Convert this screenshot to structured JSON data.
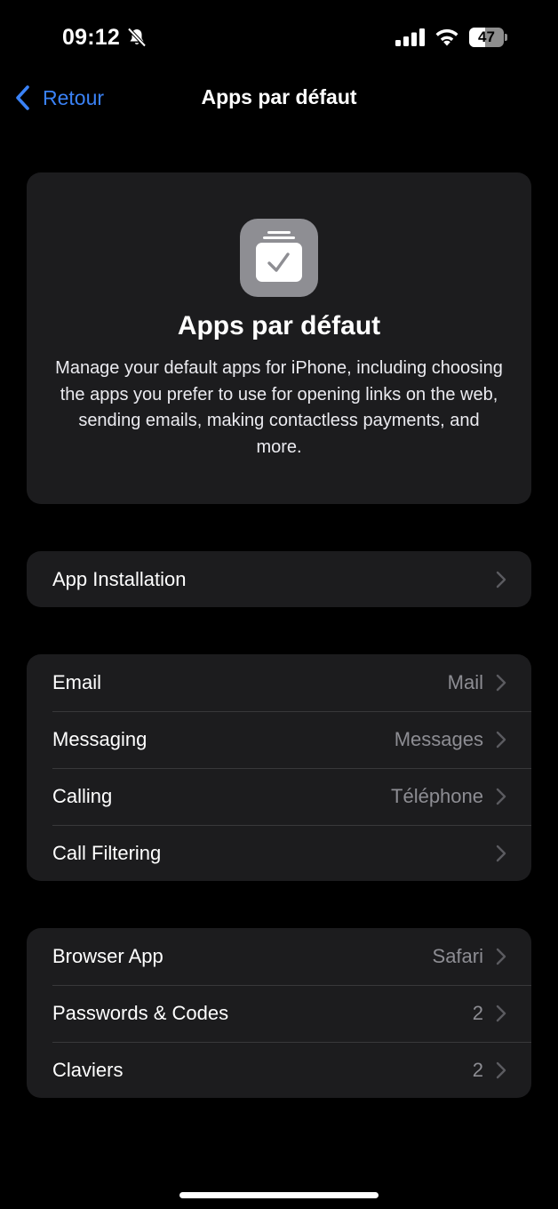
{
  "status_bar": {
    "time": "09:12",
    "silent_icon": "bell-slash-icon",
    "signal_icon": "cellular-signal-icon",
    "wifi_icon": "wifi-icon",
    "battery_percent": "47",
    "battery_level": 0.47
  },
  "nav": {
    "back_label": "Retour",
    "back_icon": "chevron-left-icon",
    "title": "Apps par défaut"
  },
  "hero": {
    "icon": "default-apps-checkmark-icon",
    "title": "Apps par défaut",
    "description": "Manage your default apps for iPhone, including choosing the apps you prefer to use for opening links on the web, sending emails, making contactless payments, and more."
  },
  "groups": [
    {
      "items": [
        {
          "label": "App Installation",
          "value": ""
        }
      ]
    },
    {
      "items": [
        {
          "label": "Email",
          "value": "Mail"
        },
        {
          "label": "Messaging",
          "value": "Messages"
        },
        {
          "label": "Calling",
          "value": "Téléphone"
        },
        {
          "label": "Call Filtering",
          "value": ""
        }
      ]
    },
    {
      "items": [
        {
          "label": "Browser App",
          "value": "Safari"
        },
        {
          "label": "Passwords & Codes",
          "value": "2"
        },
        {
          "label": "Claviers",
          "value": "2"
        }
      ]
    }
  ],
  "colors": {
    "accent": "#3a82f7",
    "background": "#000000",
    "card": "#1c1c1e",
    "secondary_text": "#8d8d93",
    "icon_tile": "#8e8e93"
  }
}
